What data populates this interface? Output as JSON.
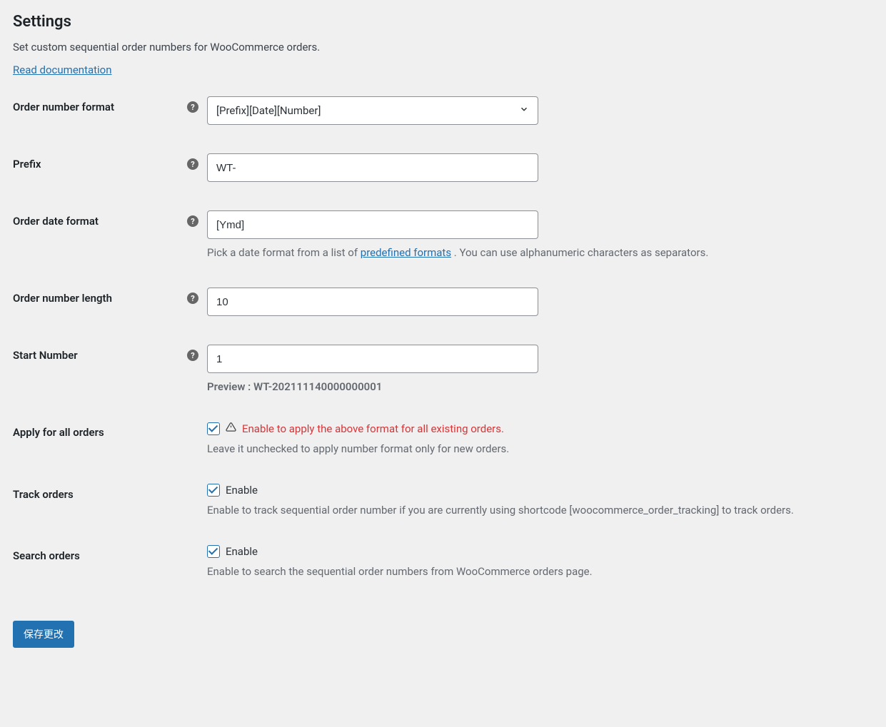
{
  "page": {
    "title": "Settings",
    "subtitle": "Set custom sequential order numbers for WooCommerce orders.",
    "doc_link": "Read documentation"
  },
  "fields": {
    "format": {
      "label": "Order number format",
      "value": "[Prefix][Date][Number]"
    },
    "prefix": {
      "label": "Prefix",
      "value": "WT-"
    },
    "date_format": {
      "label": "Order date format",
      "value": "[Ymd]",
      "desc_before": "Pick a date format from a list of ",
      "desc_link": "predefined formats",
      "desc_after": " . You can use alphanumeric characters as separators."
    },
    "length": {
      "label": "Order number length",
      "value": "10"
    },
    "start": {
      "label": "Start Number",
      "value": "1",
      "preview": "Preview : WT-202111140000000001"
    },
    "apply_all": {
      "label": "Apply for all orders",
      "checked": true,
      "warn_text": "Enable to apply the above format for all existing orders.",
      "desc": "Leave it unchecked to apply number format only for new orders."
    },
    "track": {
      "label": "Track orders",
      "checked": true,
      "enable_label": "Enable",
      "desc": "Enable to track sequential order number if you are currently using shortcode [woocommerce_order_tracking] to track orders."
    },
    "search": {
      "label": "Search orders",
      "checked": true,
      "enable_label": "Enable",
      "desc": "Enable to search the sequential order numbers from WooCommerce orders page."
    }
  },
  "buttons": {
    "save": "保存更改"
  }
}
